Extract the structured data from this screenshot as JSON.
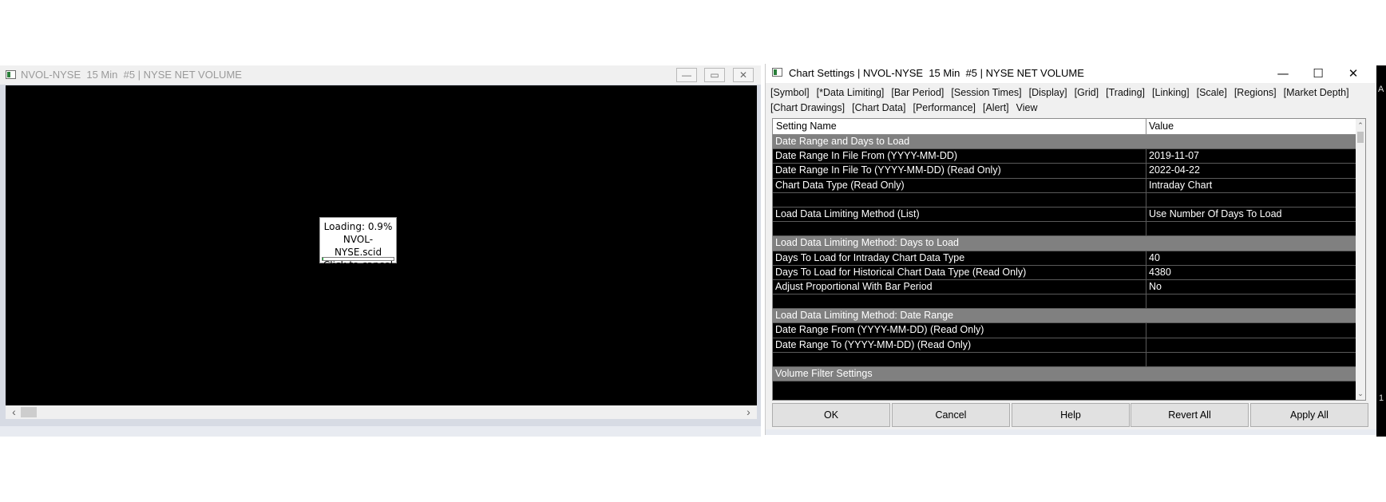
{
  "chart_window": {
    "title": "NVOL-NYSE  15 Min  #5 | NYSE NET VOLUME",
    "controls": {
      "minimize": "—",
      "restore": "▭",
      "close": "✕"
    },
    "loading": {
      "line1": "Loading: 0.9%",
      "line2": "NVOL-NYSE.scid",
      "line3": "Click to cancel",
      "progress_fraction": 0.009
    },
    "scroll": {
      "left": "‹",
      "right": "›"
    }
  },
  "dialog": {
    "title": "Chart Settings | NVOL-NYSE  15 Min  #5 | NYSE NET VOLUME",
    "window_buttons": {
      "minimize": "—",
      "maximize": "☐",
      "close": "✕"
    },
    "tabs_row1": [
      "[Symbol]",
      "[*Data Limiting]",
      "[Bar Period]",
      "[Session Times]",
      "[Display]",
      "[Grid]",
      "[Trading]",
      "[Linking]",
      "[Scale]",
      "[Regions]",
      "[Market Depth]"
    ],
    "tabs_row2": [
      "[Chart Drawings]",
      "[Chart Data]",
      "[Performance]",
      "[Alert]",
      "View"
    ],
    "grid": {
      "col_name": "Setting Name",
      "col_value": "Value",
      "rows": [
        {
          "type": "section",
          "name": "Date Range and Days to Load",
          "value": ""
        },
        {
          "type": "item",
          "name": "Date Range In File From (YYYY-MM-DD)",
          "value": "2019-11-07"
        },
        {
          "type": "item",
          "name": "Date Range In File To (YYYY-MM-DD) (Read Only)",
          "value": "2022-04-22"
        },
        {
          "type": "item",
          "name": "Chart Data Type (Read Only)",
          "value": "Intraday Chart"
        },
        {
          "type": "item",
          "name": "",
          "value": ""
        },
        {
          "type": "item",
          "name": "Load Data Limiting Method (List)",
          "value": "Use Number Of Days To Load"
        },
        {
          "type": "item",
          "name": "",
          "value": ""
        },
        {
          "type": "section",
          "name": "Load Data Limiting Method: Days to Load",
          "value": ""
        },
        {
          "type": "item",
          "name": "Days To Load for Intraday Chart Data Type",
          "value": "40"
        },
        {
          "type": "item",
          "name": "Days To Load for Historical Chart Data Type (Read Only)",
          "value": "4380"
        },
        {
          "type": "item",
          "name": "Adjust Proportional With Bar Period",
          "value": "No"
        },
        {
          "type": "item",
          "name": "",
          "value": ""
        },
        {
          "type": "section",
          "name": "Load Data Limiting Method: Date Range",
          "value": ""
        },
        {
          "type": "item",
          "name": "Date Range From (YYYY-MM-DD) (Read Only)",
          "value": ""
        },
        {
          "type": "item",
          "name": "Date Range To (YYYY-MM-DD) (Read Only)",
          "value": ""
        },
        {
          "type": "item",
          "name": "",
          "value": ""
        },
        {
          "type": "section",
          "name": "Volume Filter Settings",
          "value": ""
        }
      ]
    },
    "buttons": {
      "ok": "OK",
      "cancel": "Cancel",
      "help": "Help",
      "revert_all": "Revert All",
      "apply_all": "Apply All"
    }
  },
  "edge": {
    "top_text": "A",
    "bottom_text": "1"
  }
}
